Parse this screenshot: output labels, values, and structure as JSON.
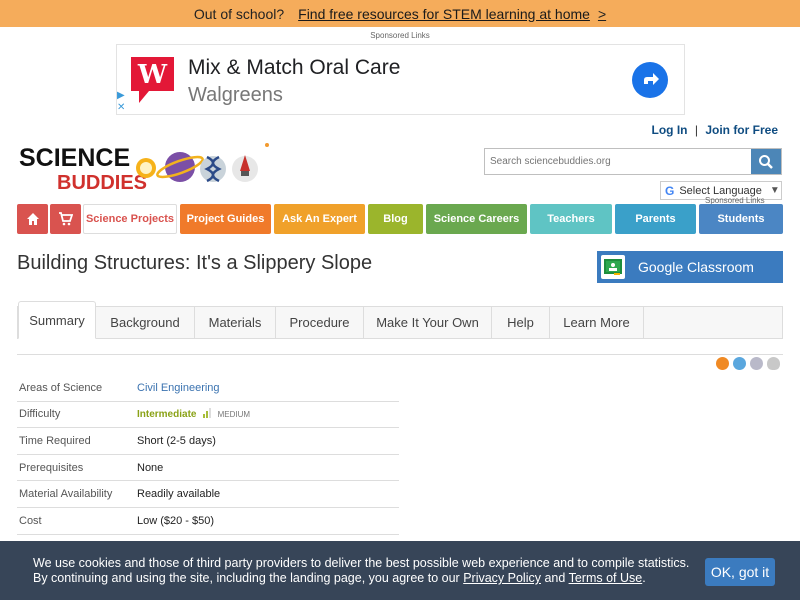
{
  "promo": {
    "text": "Out of school?",
    "link": "Find free resources for STEM learning at home",
    "arrow": ">"
  },
  "sponsored_top": "Sponsored Links",
  "ad": {
    "title": "Mix & Match Oral Care",
    "subtitle": "Walgreens",
    "colors": {
      "brand": "#e31837",
      "go": "#1a73e8"
    }
  },
  "header": {
    "login": "Log In",
    "join": "Join for Free",
    "sep": "|",
    "logo": {
      "line1": "SCIENCE",
      "line2": "BUDDIES"
    },
    "search_placeholder": "Search sciencebuddies.org",
    "language": "Select Language",
    "language_caret": "▼",
    "language_sponsored": "Sponsored Links"
  },
  "nav": [
    {
      "label": "",
      "icon": "home-icon",
      "color": "#d9534f"
    },
    {
      "label": "",
      "icon": "cart-icon",
      "color": "#d9534f"
    },
    {
      "label": "Science Projects",
      "color": "#ffffff",
      "text": "#d9534f"
    },
    {
      "label": "Project Guides",
      "color": "#f07a2a"
    },
    {
      "label": "Ask An Expert",
      "color": "#f0a12a"
    },
    {
      "label": "Blog",
      "color": "#9bb52c"
    },
    {
      "label": "Science Careers",
      "color": "#6aa84f"
    },
    {
      "label": "Teachers",
      "color": "#5fc4c4"
    },
    {
      "label": "Parents",
      "color": "#3aa0c9"
    },
    {
      "label": "Students",
      "color": "#4b86c4"
    }
  ],
  "page": {
    "title": "Building Structures: It's a Slippery Slope",
    "google_classroom": "Google Classroom"
  },
  "tabs": [
    "Summary",
    "Background",
    "Materials",
    "Procedure",
    "Make It Your Own",
    "Help",
    "Learn More"
  ],
  "summary": [
    {
      "key": "Areas of Science",
      "value": "Civil Engineering",
      "link": true
    },
    {
      "key": "Difficulty",
      "value": "Intermediate",
      "level": "MEDIUM",
      "difficulty_level_fraction": 0.6
    },
    {
      "key": "Time Required",
      "value": "Short (2-5 days)"
    },
    {
      "key": "Prerequisites",
      "value": "None"
    },
    {
      "key": "Material Availability",
      "value": "Readily available"
    },
    {
      "key": "Cost",
      "value": "Low ($20 - $50)"
    }
  ],
  "cookie": {
    "line1": "We use cookies and those of third party providers to deliver the best possible web experience and to compile statistics.",
    "line2_pre": "By continuing and using the site, including the landing page, you agree to our",
    "privacy": "Privacy Policy",
    "and": "and",
    "terms": "Terms of Use",
    "end": ".",
    "ok": "OK, got it"
  }
}
